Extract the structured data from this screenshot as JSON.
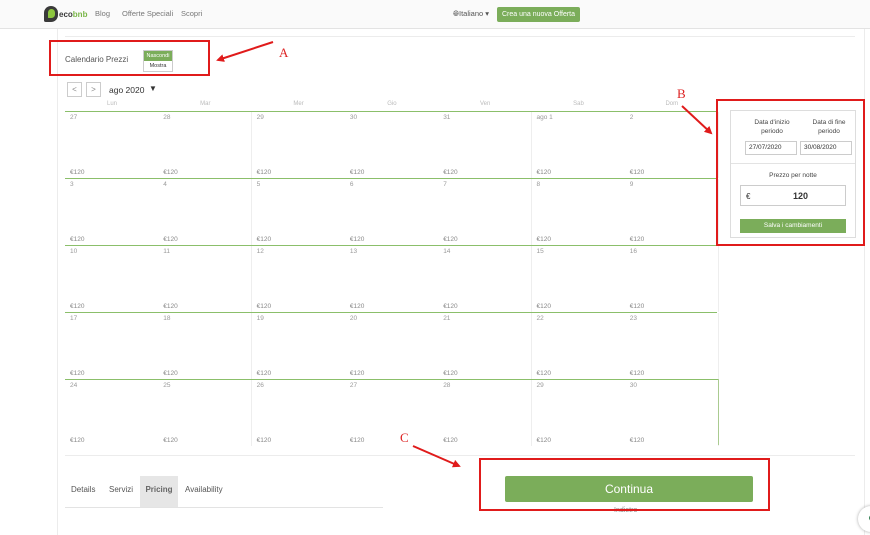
{
  "nav": {
    "logo_text_dark": "eco",
    "logo_text_green": "bnb",
    "links": [
      "Blog",
      "Offerte Speciali",
      "Scopri"
    ],
    "language": "Italiano",
    "create_offer_button": "Crea una nuova Offerta"
  },
  "calendar": {
    "heading": "Calendario Prezzi",
    "toggle_options": [
      "Nascondi",
      "Mostra"
    ],
    "toggle_active": "Nascondi",
    "prev_button": "<",
    "next_button": ">",
    "month": "ago 2020",
    "month_caret": "▼",
    "weekdays": [
      "Lun",
      "Mar",
      "Mer",
      "Gio",
      "Ven",
      "Sab",
      "Dom"
    ],
    "price": "€120",
    "weeks": [
      [
        "27",
        "28",
        "29",
        "30",
        "31",
        "ago 1",
        "2"
      ],
      [
        "3",
        "4",
        "5",
        "6",
        "7",
        "8",
        "9"
      ],
      [
        "10",
        "11",
        "12",
        "13",
        "14",
        "15",
        "16"
      ],
      [
        "17",
        "18",
        "19",
        "20",
        "21",
        "22",
        "23"
      ],
      [
        "24",
        "25",
        "26",
        "27",
        "28",
        "29",
        "30"
      ]
    ]
  },
  "period_panel": {
    "start_label_1": "Data d'inizio",
    "start_label_2": "periodo",
    "end_label_1": "Data di fine",
    "end_label_2": "periodo",
    "start_date": "27/07/2020",
    "end_date": "30/08/2020",
    "price_label": "Prezzo per notte",
    "currency": "€",
    "price_value": "120",
    "save_button": "Salva i cambiamenti"
  },
  "tabs": [
    {
      "label": "Details",
      "active": false
    },
    {
      "label": "Servizi",
      "active": false
    },
    {
      "label": "Pricing",
      "active": true
    },
    {
      "label": "Availability",
      "active": false
    }
  ],
  "continue_button": "Continua",
  "under_button_text": "Indietro",
  "annotations": {
    "a": "A",
    "b": "B",
    "c": "C"
  },
  "colors": {
    "accent_green": "#7bad5a",
    "annotation_red": "#e01b1b"
  }
}
